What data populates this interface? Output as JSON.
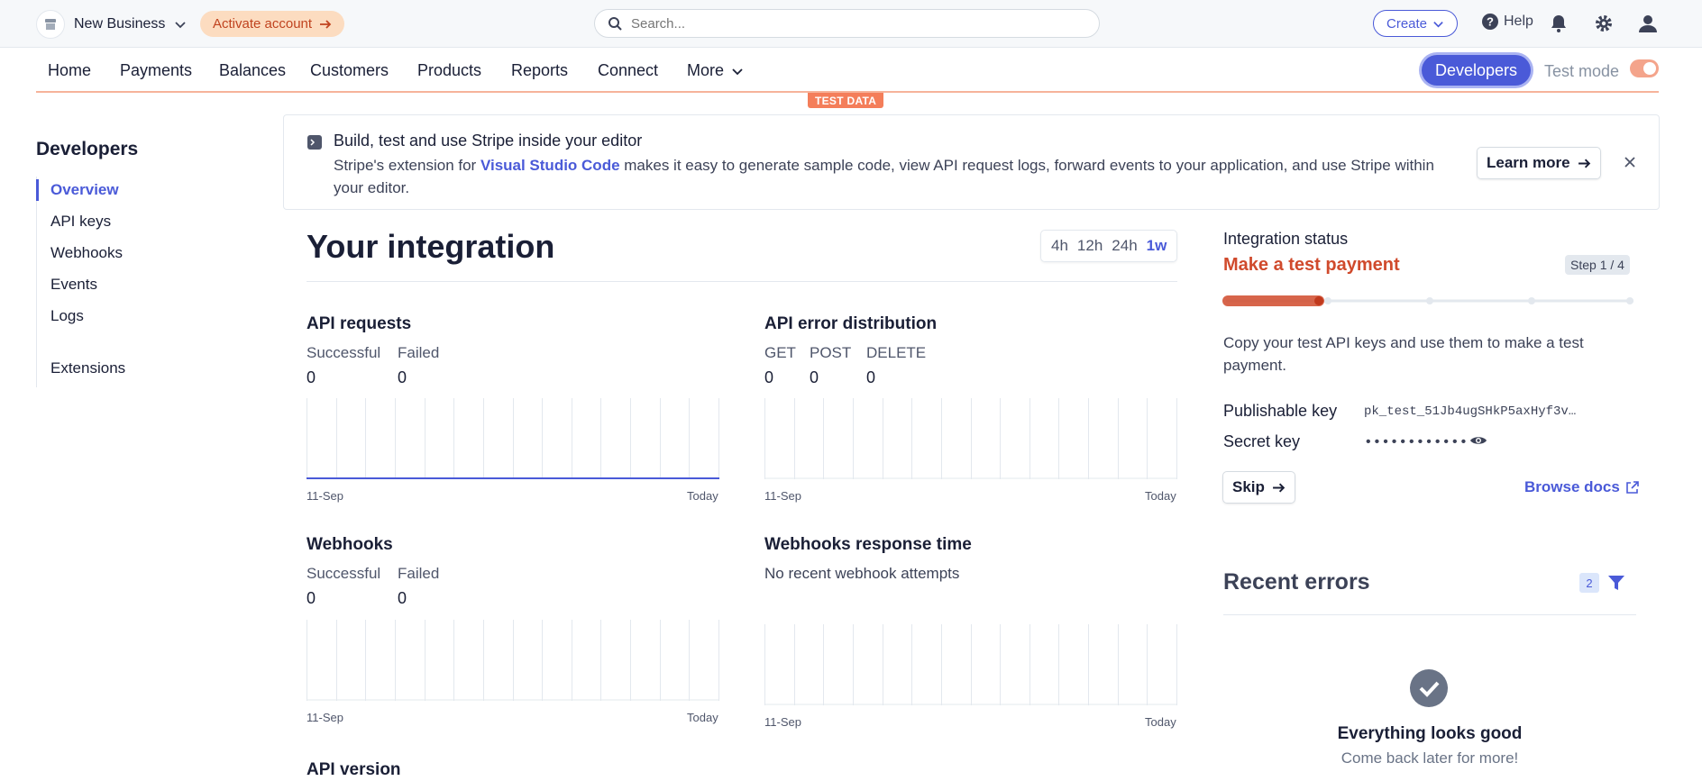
{
  "topbar": {
    "business_name": "New Business",
    "activate_label": "Activate account",
    "search_placeholder": "Search...",
    "create_label": "Create",
    "help_label": "Help"
  },
  "nav": {
    "items": [
      "Home",
      "Payments",
      "Balances",
      "Customers",
      "Products",
      "Reports",
      "Connect",
      "More"
    ],
    "developers_label": "Developers",
    "test_mode_label": "Test mode",
    "test_mode_on": true,
    "test_data_badge": "TEST DATA"
  },
  "sidebar": {
    "title": "Developers",
    "items": [
      "Overview",
      "API keys",
      "Webhooks",
      "Events",
      "Logs",
      "Extensions"
    ],
    "active": "Overview"
  },
  "banner": {
    "title": "Build, test and use Stripe inside your editor",
    "body_before": "Stripe's extension for ",
    "body_link": "Visual Studio Code",
    "body_after": " makes it easy to generate sample code, view API request logs, forward events to your application, and use Stripe within your editor.",
    "learn_more": "Learn more"
  },
  "integration": {
    "title": "Your integration",
    "ranges": [
      "4h",
      "12h",
      "24h",
      "1w"
    ],
    "selected_range": "1w",
    "api_requests": {
      "title": "API requests",
      "labels": [
        "Successful",
        "Failed"
      ],
      "values": [
        "0",
        "0"
      ],
      "x_start": "11-Sep",
      "x_end": "Today"
    },
    "api_errors": {
      "title": "API error distribution",
      "labels": [
        "GET",
        "POST",
        "DELETE"
      ],
      "values": [
        "0",
        "0",
        "0"
      ],
      "x_start": "11-Sep",
      "x_end": "Today"
    },
    "webhooks": {
      "title": "Webhooks",
      "labels": [
        "Successful",
        "Failed"
      ],
      "values": [
        "0",
        "0"
      ],
      "x_start": "11-Sep",
      "x_end": "Today"
    },
    "webhook_time": {
      "title": "Webhooks response time",
      "empty_text": "No recent webhook attempts",
      "x_start": "11-Sep",
      "x_end": "Today"
    },
    "api_version_title": "API version"
  },
  "status": {
    "label": "Integration status",
    "title": "Make a test payment",
    "step": "Step 1 / 4",
    "progress": 0.25,
    "description": "Copy your test API keys and use them to make a test payment.",
    "publishable_label": "Publishable key",
    "publishable_value": "pk_test_51Jb4ugSHkP5axHyf3v…",
    "secret_label": "Secret key",
    "secret_value": "••••••••••••",
    "skip_label": "Skip",
    "browse_label": "Browse docs"
  },
  "recent_errors": {
    "title": "Recent errors",
    "count": "2",
    "ok_title": "Everything looks good",
    "ok_sub": "Come back later for more!"
  },
  "colors": {
    "accent": "#4a5ad8",
    "test_orange": "#f47e5a",
    "status_red": "#d04a2c"
  }
}
